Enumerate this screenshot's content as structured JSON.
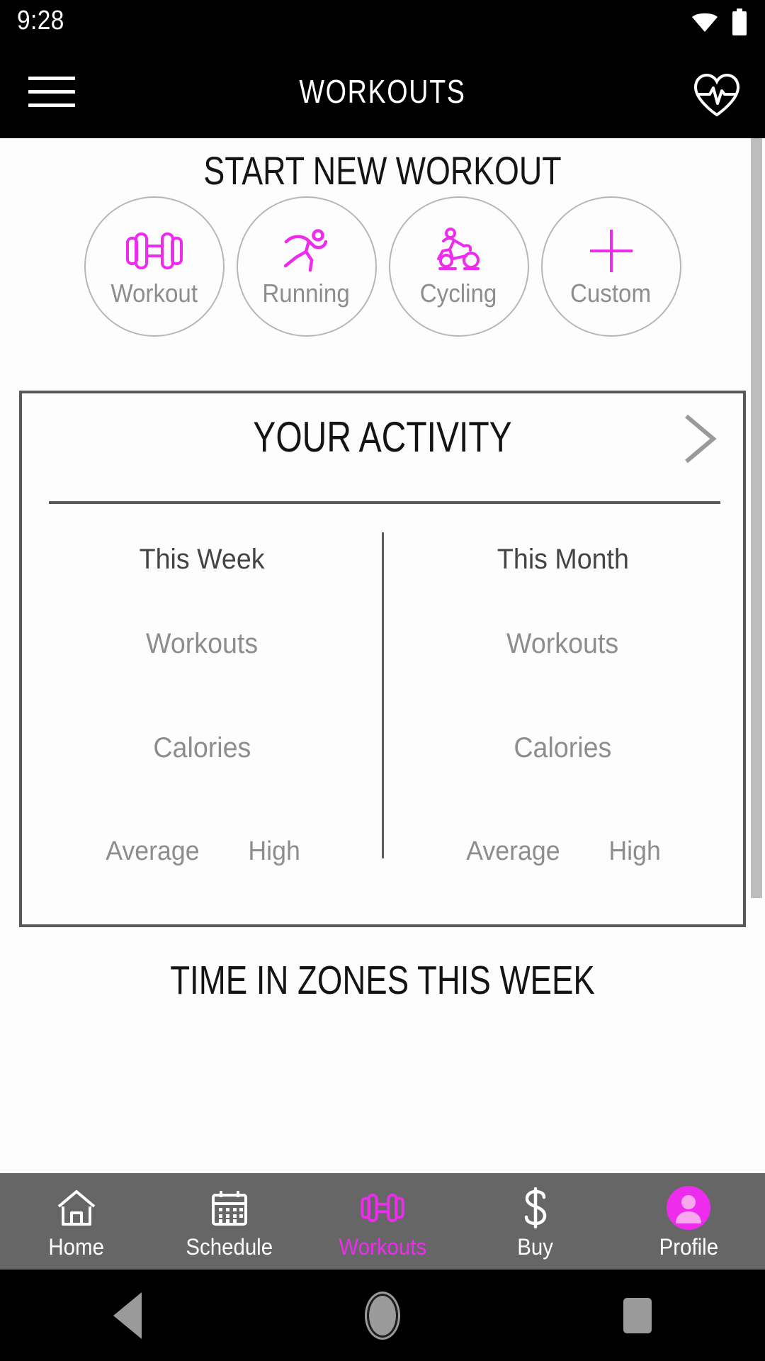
{
  "status_bar": {
    "clock": "9:28",
    "icons": [
      "wifi-icon",
      "battery-icon"
    ]
  },
  "app_bar": {
    "menu_icon": "hamburger-menu-icon",
    "title": "WORKOUTS",
    "action_icon": "heart-rate-icon"
  },
  "start_workout": {
    "title": "START NEW WORKOUT",
    "types": [
      {
        "label": "Workout",
        "icon": "dumbbell-icon"
      },
      {
        "label": "Running",
        "icon": "running-person-icon"
      },
      {
        "label": "Cycling",
        "icon": "cyclist-icon"
      },
      {
        "label": "Custom",
        "icon": "plus-icon"
      }
    ]
  },
  "activity": {
    "title": "YOUR ACTIVITY",
    "chevron_icon": "chevron-right-icon",
    "columns": [
      {
        "period": "This Week",
        "workouts_label": "Workouts",
        "workouts_value": "",
        "calories_label": "Calories",
        "calories_value": "",
        "hr_average_label": "Average",
        "hr_average_value": "",
        "hr_high_label": "High",
        "hr_high_value": ""
      },
      {
        "period": "This Month",
        "workouts_label": "Workouts",
        "workouts_value": "",
        "calories_label": "Calories",
        "calories_value": "",
        "hr_average_label": "Average",
        "hr_average_value": "",
        "hr_high_label": "High",
        "hr_high_value": ""
      }
    ]
  },
  "zones": {
    "title": "TIME IN ZONES THIS WEEK"
  },
  "bottom_nav": {
    "items": [
      {
        "label": "Home",
        "icon": "home-icon",
        "active": false
      },
      {
        "label": "Schedule",
        "icon": "calendar-icon",
        "active": false
      },
      {
        "label": "Workouts",
        "icon": "dumbbell-icon",
        "active": true
      },
      {
        "label": "Buy",
        "icon": "dollar-icon",
        "active": false
      },
      {
        "label": "Profile",
        "icon": "avatar-icon",
        "active": false
      }
    ]
  },
  "android_nav": {
    "back": "back-triangle-icon",
    "home": "home-circle-icon",
    "recents": "recents-square-icon"
  },
  "colors": {
    "accent": "#EE2CEE",
    "app_bar_bg": "#000000",
    "content_bg": "#FDFDFD",
    "nav_bg": "#666666",
    "card_border": "#58595B",
    "muted_text": "#8D8D8D",
    "circle_border": "#B6B6B6",
    "scrollbar": "#BDBDBD"
  }
}
